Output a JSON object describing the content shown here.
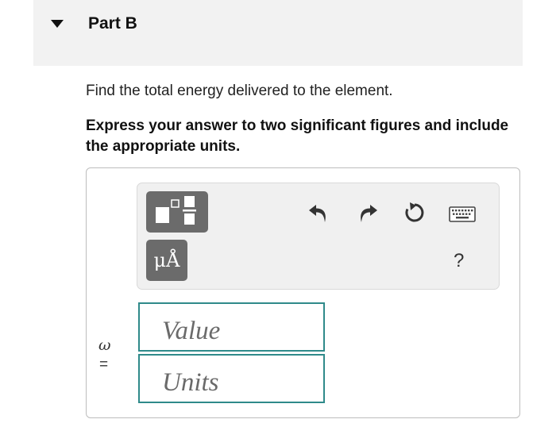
{
  "part": {
    "title": "Part B"
  },
  "question": "Find the total energy delivered to the element.",
  "instruction": "Express your answer to two significant figures and include the appropriate units.",
  "toolbar": {
    "template_icon": "fraction-template-icon",
    "units_label": "μÅ",
    "undo_icon": "undo-icon",
    "redo_icon": "redo-icon",
    "reset_icon": "reset-icon",
    "keyboard_icon": "keyboard-icon",
    "help_label": "?"
  },
  "answer": {
    "variable": "ω",
    "equals": "=",
    "value_placeholder": "Value",
    "units_placeholder": "Units"
  },
  "colors": {
    "field_border": "#2f8a8a",
    "button_bg": "#6b6b6b",
    "header_bg": "#f2f2f2"
  }
}
